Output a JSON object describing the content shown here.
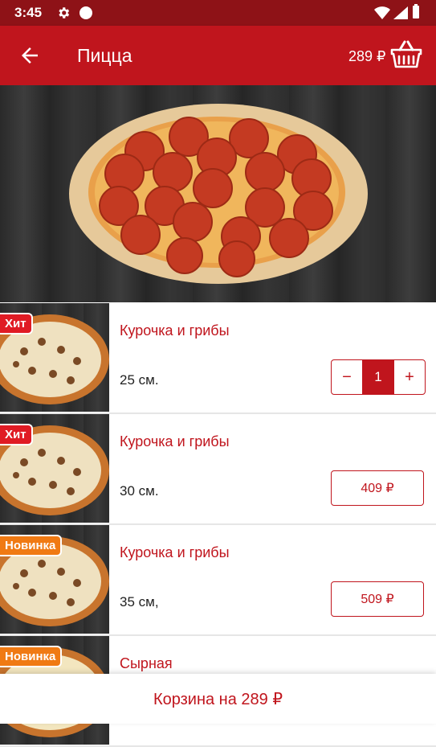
{
  "status_bar": {
    "time": "3:45"
  },
  "app_bar": {
    "title": "Пицца",
    "cart_amount": "289 ₽"
  },
  "products": [
    {
      "badge": "Хит",
      "badge_type": "hit",
      "name": "Курочка и грибы",
      "size": "25 см.",
      "quantity": "1",
      "stepper_minus": "−",
      "stepper_plus": "+"
    },
    {
      "badge": "Хит",
      "badge_type": "hit",
      "name": "Курочка и грибы",
      "size": "30 см.",
      "price": "409 ₽"
    },
    {
      "badge": "Новинка",
      "badge_type": "new",
      "name": "Курочка и грибы",
      "size": "35 см,",
      "price": "509 ₽"
    },
    {
      "badge": "Новинка",
      "badge_type": "new",
      "name": "Сырная"
    }
  ],
  "bottom_bar": {
    "label": "Корзина на 289 ₽"
  },
  "colors": {
    "primary": "#c0151d",
    "status_bar": "#8e1217",
    "badge_hit": "#e01b24",
    "badge_new": "#f07a13"
  }
}
